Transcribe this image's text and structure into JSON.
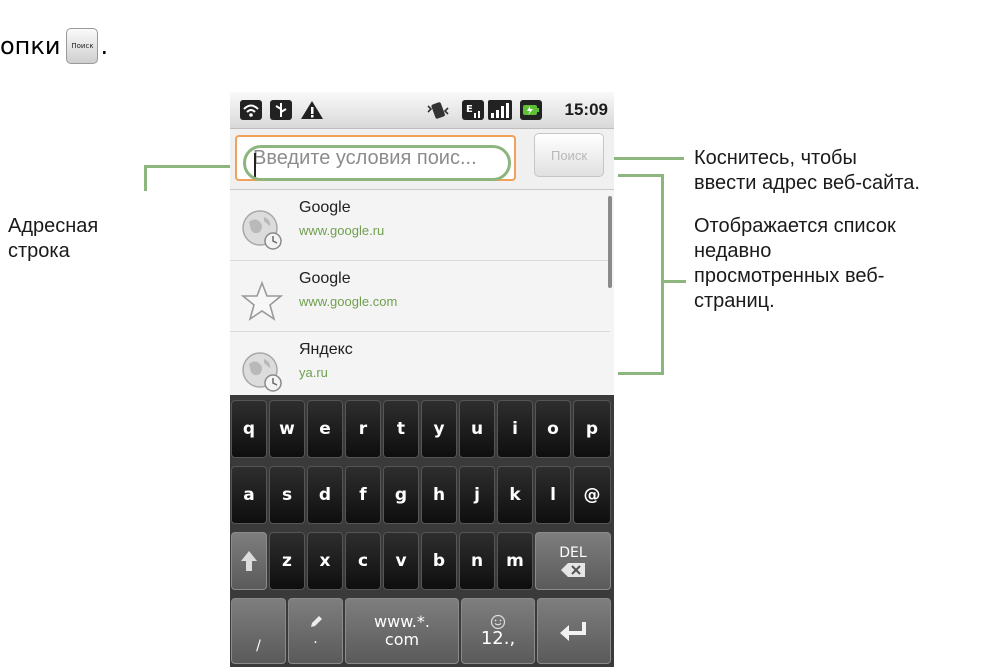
{
  "top_instruction": {
    "text": "опки",
    "button_label": "Поиск",
    "trailing": "."
  },
  "callouts": {
    "address_bar_line1": "Адресная",
    "address_bar_line2": "строка",
    "touch_line1": "Коснитесь, чтобы",
    "touch_line2": "ввести адрес веб-сайта.",
    "list_line1": "Отображается список",
    "list_line2": "недавно",
    "list_line3": "просмотренных веб-",
    "list_line4": "страниц."
  },
  "status_bar": {
    "time": "15:09",
    "icons": [
      "wifi-icon",
      "usb-icon",
      "warning-icon",
      "vibrate-icon",
      "edge-data-icon",
      "signal-icon",
      "battery-charging-icon"
    ]
  },
  "url_bar": {
    "placeholder": "Введите условия поис...",
    "value": "",
    "search_button_label": "Поиск"
  },
  "history": [
    {
      "title": "Google",
      "url": "www.google.ru",
      "icon": "globe-history-icon"
    },
    {
      "title": "Google",
      "url": "www.google.com",
      "icon": "star-icon"
    },
    {
      "title": "Яндекс",
      "url": "ya.ru",
      "icon": "globe-history-icon"
    }
  ],
  "keyboard": {
    "row1": [
      "q",
      "w",
      "e",
      "r",
      "t",
      "y",
      "u",
      "i",
      "o",
      "p"
    ],
    "row2": [
      "a",
      "s",
      "d",
      "f",
      "g",
      "h",
      "j",
      "k",
      "l",
      "@"
    ],
    "row3": [
      "z",
      "x",
      "c",
      "v",
      "b",
      "n",
      "m"
    ],
    "del_label": "DEL",
    "slash": "/",
    "dot": ".",
    "www_line1": "www.*.",
    "www_line2": "com",
    "sym_label": "12.,",
    "icons": [
      "shift-icon",
      "backspace-icon",
      "pencil-icon",
      "smiley-icon",
      "enter-icon"
    ]
  },
  "colors": {
    "callout_green": "#8db57e",
    "field_focus_orange": "#f0a15a",
    "url_green": "#6f9f4e"
  }
}
